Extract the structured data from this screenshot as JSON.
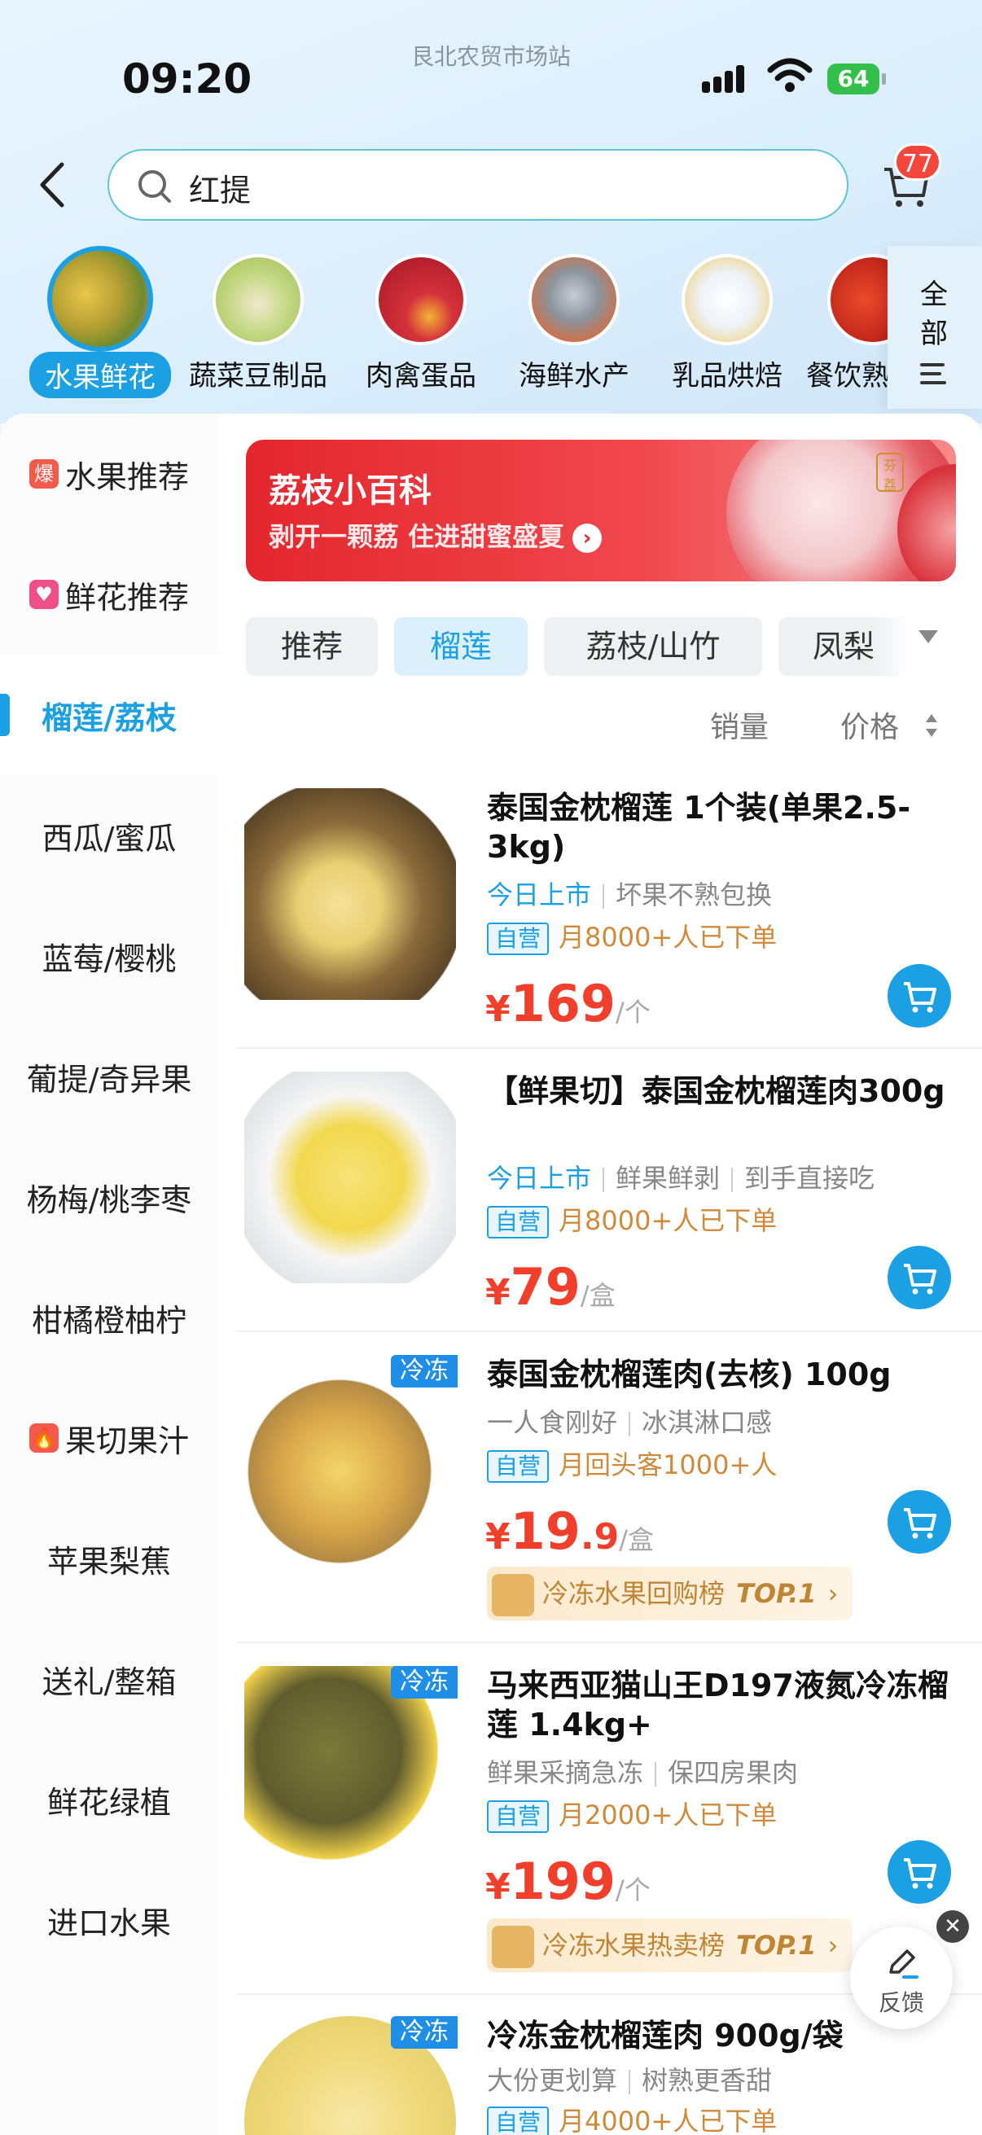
{
  "status_bar": {
    "time": "09:20",
    "station": "艮北农贸市场站",
    "battery": "64"
  },
  "search": {
    "query": "红提",
    "cart_count": "77"
  },
  "categories": [
    {
      "label": "水果鲜花",
      "active": true
    },
    {
      "label": "蔬菜豆制品"
    },
    {
      "label": "肉禽蛋品"
    },
    {
      "label": "海鲜水产"
    },
    {
      "label": "乳品烘焙"
    },
    {
      "label": "餐饮熟"
    }
  ],
  "all_label": "全部",
  "sidebar": {
    "items": [
      {
        "label": "水果推荐",
        "icon": "爆"
      },
      {
        "label": "鲜花推荐",
        "icon": "heart"
      },
      {
        "label": "榴莲/荔枝",
        "active": true
      },
      {
        "label": "西瓜/蜜瓜"
      },
      {
        "label": "蓝莓/樱桃"
      },
      {
        "label": "葡提/奇异果"
      },
      {
        "label": "杨梅/桃李枣"
      },
      {
        "label": "柑橘橙柚柠"
      },
      {
        "label": "果切果汁",
        "icon": "fire"
      },
      {
        "label": "苹果梨蕉"
      },
      {
        "label": "送礼/整箱"
      },
      {
        "label": "鲜花绿植"
      },
      {
        "label": "进口水果"
      }
    ]
  },
  "banner": {
    "title": "荔枝小百科",
    "subtitle": "剥开一颗荔 住进甜蜜盛夏",
    "seal": "芬荔"
  },
  "subtabs": [
    "推荐",
    "榴莲",
    "荔枝/山竹",
    "凤梨"
  ],
  "sort": {
    "sales": "销量",
    "price": "价格"
  },
  "products": [
    {
      "name": "泰国金枕榴莲 1个装(单果2.5-3kg)",
      "tag1": "今日上市",
      "tag2": "坏果不熟包换",
      "tag3": "",
      "self_tag": "自营",
      "sales": "月8000+人已下单",
      "yen": "¥",
      "price": "169",
      "decimal": "",
      "unit": "/个",
      "frozen": "",
      "rank": ""
    },
    {
      "name": "【鲜果切】泰国金枕榴莲肉300g",
      "tag1": "今日上市",
      "tag2": "鲜果鲜剥",
      "tag3": "到手直接吃",
      "self_tag": "自营",
      "sales": "月8000+人已下单",
      "yen": "¥",
      "price": "79",
      "decimal": "",
      "unit": "/盒",
      "frozen": "",
      "rank": ""
    },
    {
      "name": "泰国金枕榴莲肉(去核) 100g",
      "tag1": "一人食刚好",
      "tag2": "冰淇淋口感",
      "tag3": "",
      "self_tag": "自营",
      "sales": "月回头客1000+人",
      "yen": "¥",
      "price": "19",
      "decimal": ".9",
      "unit": "/盒",
      "frozen": "冷冻",
      "rank": "冷冻水果回购榜",
      "rank_top": "TOP.1"
    },
    {
      "name": "马来西亚猫山王D197液氮冷冻榴莲 1.4kg+",
      "tag1": "鲜果采摘急冻",
      "tag2": "保四房果肉",
      "tag3": "",
      "self_tag": "自营",
      "sales": "月2000+人已下单",
      "yen": "¥",
      "price": "199",
      "decimal": "",
      "unit": "/个",
      "frozen": "冷冻",
      "rank": "冷冻水果热卖榜",
      "rank_top": "TOP.1"
    },
    {
      "name": "冷冻金枕榴莲肉 900g/袋",
      "tag1": "大份更划算",
      "tag2": "树熟更香甜",
      "tag3": "",
      "self_tag": "自营",
      "sales": "月4000+人已下单",
      "yen": "",
      "price": "",
      "decimal": "",
      "unit": "",
      "frozen": "冷冻",
      "rank": ""
    }
  ],
  "feedback": "反馈",
  "colors": {
    "accent": "#1aa0e3",
    "price": "#f23f2c",
    "banner": "#e3262d"
  }
}
